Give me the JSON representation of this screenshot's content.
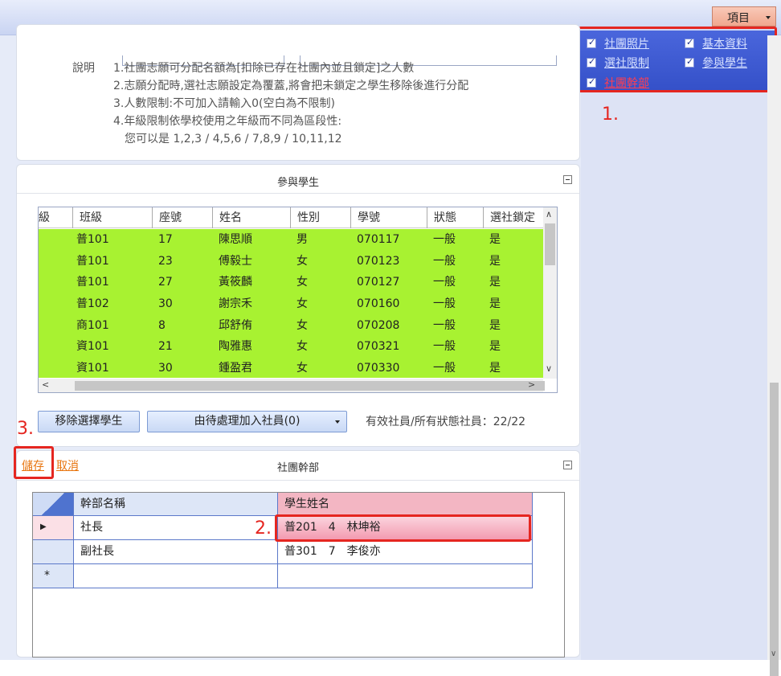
{
  "top": {
    "menu_label": "項目"
  },
  "checkboxes": [
    {
      "label": "社團照片",
      "checked": true,
      "active": false
    },
    {
      "label": "基本資料",
      "checked": true,
      "active": false
    },
    {
      "label": "選社限制",
      "checked": true,
      "active": false
    },
    {
      "label": "參與學生",
      "checked": true,
      "active": false
    },
    {
      "label": "社團幹部",
      "checked": true,
      "active": true
    }
  ],
  "annotations": {
    "one": "1.",
    "two": "2.",
    "three": "3."
  },
  "description": {
    "label": "說明",
    "lines": [
      "1.社團志願可分配名額為[扣除已存在社團內並且鎖定]之人數",
      "2.志願分配時,選社志願設定為覆蓋,將會把未鎖定之學生移除後進行分配",
      "3.人數限制:不可加入請輸入0(空白為不限制)",
      "4.年級限制依學校使用之年級而不同為區段性:",
      "您可以是 1,2,3 / 4,5,6 / 7,8,9 / 10,11,12"
    ]
  },
  "students_panel": {
    "title": "參與學生",
    "columns": [
      "級",
      "班級",
      "座號",
      "姓名",
      "性別",
      "學號",
      "狀態",
      "選社鎖定"
    ],
    "rows": [
      [
        "普101",
        "17",
        "陳思順",
        "男",
        "070117",
        "一般",
        "是"
      ],
      [
        "普101",
        "23",
        "傅毅士",
        "女",
        "070123",
        "一般",
        "是"
      ],
      [
        "普101",
        "27",
        "黃筱麟",
        "女",
        "070127",
        "一般",
        "是"
      ],
      [
        "普102",
        "30",
        "謝宗禾",
        "女",
        "070160",
        "一般",
        "是"
      ],
      [
        "商101",
        "8",
        "邱舒侑",
        "女",
        "070208",
        "一般",
        "是"
      ],
      [
        "資101",
        "21",
        "陶雅惠",
        "女",
        "070321",
        "一般",
        "是"
      ],
      [
        "資101",
        "30",
        "鍾盈君",
        "女",
        "070330",
        "一般",
        "是"
      ]
    ],
    "remove_button": "移除選擇學生",
    "add_button": "由待處理加入社員(0)",
    "status": "有效社員/所有狀態社員：22/22"
  },
  "cadre_panel": {
    "title": "社團幹部",
    "save": "儲存",
    "cancel": "取消",
    "columns": [
      "幹部名稱",
      "學生姓名"
    ],
    "rows": [
      {
        "role": "社長",
        "student": "普201　4　林坤裕"
      },
      {
        "role": "副社長",
        "student": "普301　7　李俊亦"
      }
    ],
    "new_row_marker": "*"
  }
}
